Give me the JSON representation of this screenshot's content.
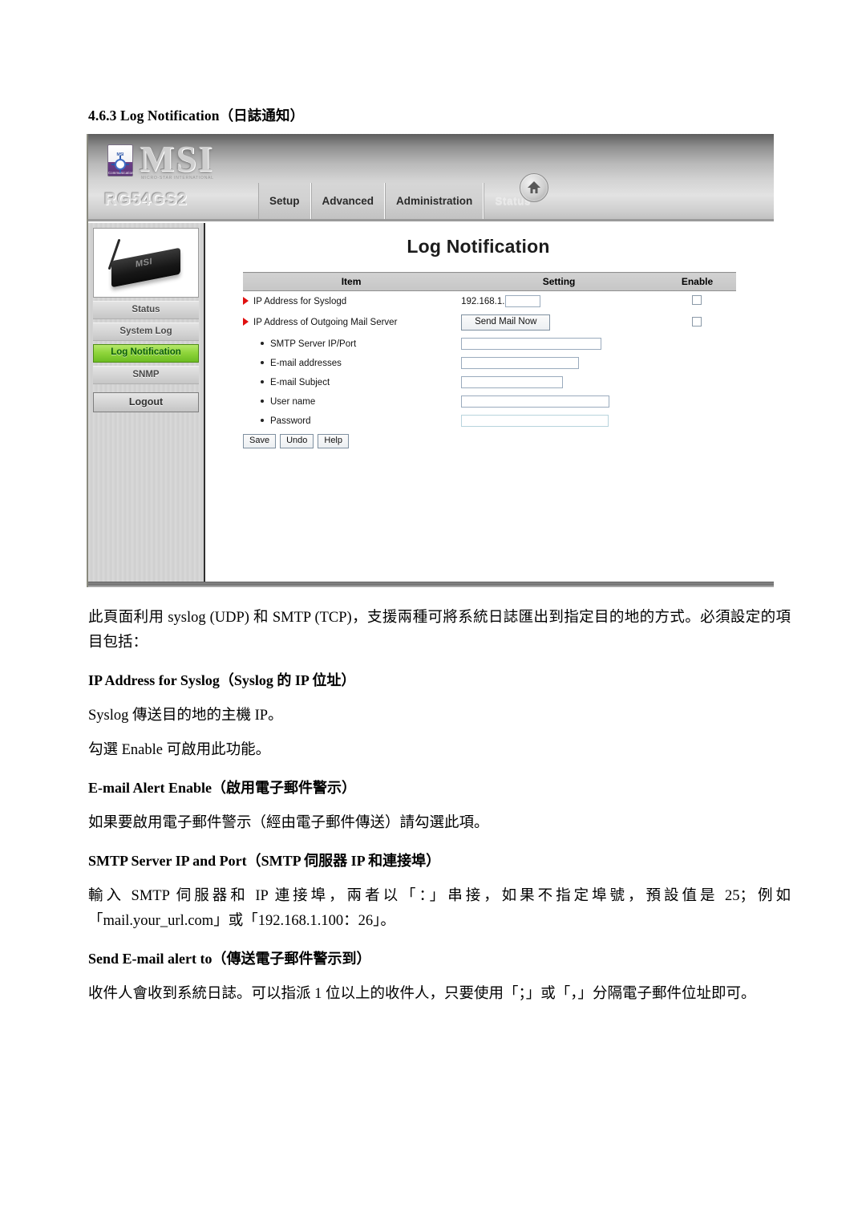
{
  "document": {
    "heading": "4.6.3 Log Notification（日誌通知）"
  },
  "screenshot": {
    "header": {
      "brand": "MSI",
      "brand_tagline": "MICRO-STAR INTERNATIONAL",
      "badge_label": "MSI",
      "badge_foot": "Communication",
      "model": "RG54GS2",
      "tabs": [
        {
          "label": "Setup",
          "active": false
        },
        {
          "label": "Advanced",
          "active": false
        },
        {
          "label": "Administration",
          "active": false
        },
        {
          "label": "Status",
          "active": true
        }
      ],
      "home_icon": "home-icon"
    },
    "sidebar": {
      "device_label": "MSI",
      "items": [
        {
          "label": "Status",
          "selected": false
        },
        {
          "label": "System Log",
          "selected": false
        },
        {
          "label": "Log Notification",
          "selected": true
        },
        {
          "label": "SNMP",
          "selected": false
        }
      ],
      "logout_label": "Logout"
    },
    "content": {
      "page_title": "Log Notification",
      "table_headers": {
        "item": "Item",
        "setting": "Setting",
        "enable": "Enable"
      },
      "rows": [
        {
          "label": "IP Address for Syslogd",
          "marker": "arrow",
          "ip_prefix": "192.168.1.",
          "value": "",
          "enable_checked": false
        },
        {
          "label": "IP Address of Outgoing Mail Server",
          "marker": "arrow",
          "button_label": "Send Mail Now",
          "enable_checked": false
        },
        {
          "label": "SMTP Server IP/Port",
          "marker": "bullet",
          "value": ""
        },
        {
          "label": "E-mail addresses",
          "marker": "bullet",
          "value": ""
        },
        {
          "label": "E-mail Subject",
          "marker": "bullet",
          "value": ""
        },
        {
          "label": "User name",
          "marker": "bullet",
          "value": ""
        },
        {
          "label": "Password",
          "marker": "bullet",
          "value": ""
        }
      ],
      "buttons": {
        "save": "Save",
        "undo": "Undo",
        "help": "Help"
      }
    }
  },
  "body": {
    "intro": "此頁面利用 syslog (UDP) 和 SMTP (TCP)，支援兩種可將系統日誌匯出到指定目的地的方式。必須設定的項目包括：",
    "section1_heading": "IP Address for Syslog（Syslog 的 IP 位址）",
    "section1_line1": "Syslog 傳送目的地的主機 IP。",
    "section1_line2": "勾選 Enable 可啟用此功能。",
    "section2_heading": "E-mail Alert Enable（啟用電子郵件警示）",
    "section2_text": "如果要啟用電子郵件警示（經由電子郵件傳送）請勾選此項。",
    "section3_heading": "SMTP Server IP and Port（SMTP 伺服器 IP 和連接埠）",
    "section3_text": "輸入 SMTP 伺服器和 IP 連接埠，兩者以「：」串接，如果不指定埠號，預設值是 25；例如「mail.your_url.com」或「192.168.1.100：26」。",
    "section4_heading": "Send E-mail alert to（傳送電子郵件警示到）",
    "section4_text": "收件人會收到系統日誌。可以指派 1 位以上的收件人，只要使用「；」或「，」分隔電子郵件位址即可。"
  },
  "colors": {
    "accent_selected": "#8ed43a",
    "marker_red": "#e01010",
    "header_gray": "#c6c6c6"
  }
}
